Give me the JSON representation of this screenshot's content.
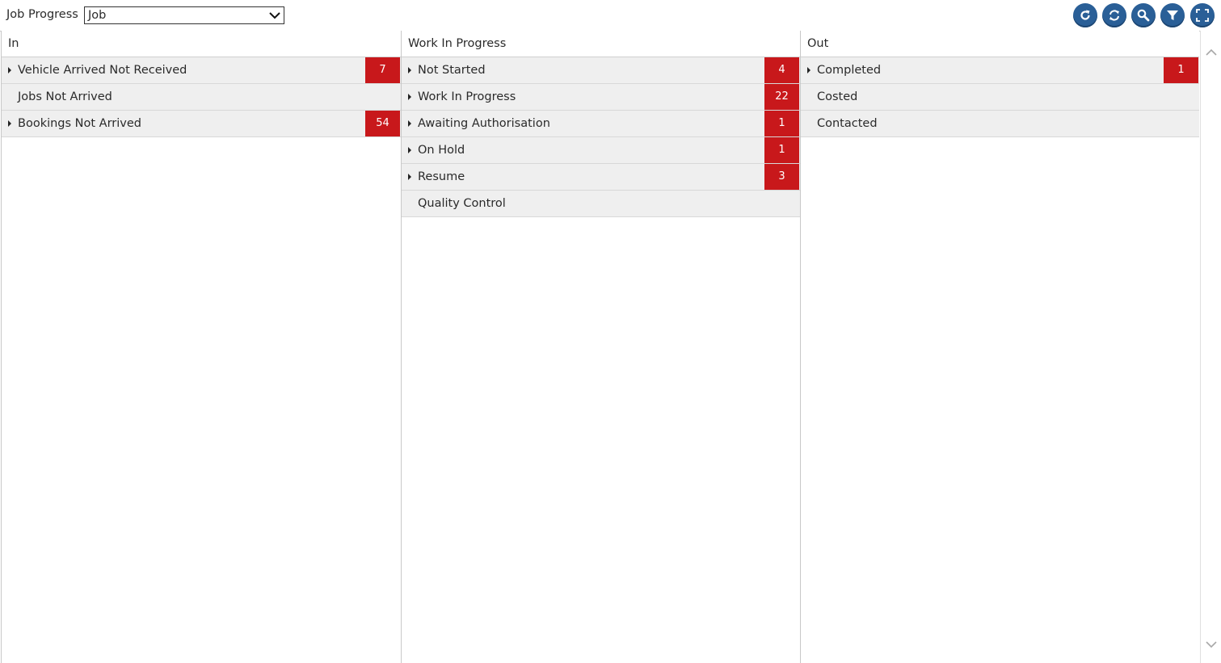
{
  "toolbar": {
    "page_label": "Job Progress",
    "view_select": {
      "value": "Job"
    },
    "buttons": [
      {
        "name": "refresh-button",
        "icon": "refresh-icon"
      },
      {
        "name": "sync-button",
        "icon": "sync-icon"
      },
      {
        "name": "search-button",
        "icon": "search-icon"
      },
      {
        "name": "filter-button",
        "icon": "filter-icon"
      },
      {
        "name": "fullscreen-button",
        "icon": "fullscreen-icon"
      }
    ],
    "accent_color": "#2a5f97"
  },
  "badge_color": "#c8181b",
  "columns": [
    {
      "title": "In",
      "rows": [
        {
          "label": "Vehicle Arrived Not Received",
          "expandable": true,
          "count": "7"
        },
        {
          "label": "Jobs Not Arrived",
          "expandable": false,
          "count": ""
        },
        {
          "label": "Bookings Not Arrived",
          "expandable": true,
          "count": "54"
        }
      ]
    },
    {
      "title": "Work In Progress",
      "rows": [
        {
          "label": "Not Started",
          "expandable": true,
          "count": "4"
        },
        {
          "label": "Work In Progress",
          "expandable": true,
          "count": "22"
        },
        {
          "label": "Awaiting Authorisation",
          "expandable": true,
          "count": "1"
        },
        {
          "label": "On Hold",
          "expandable": true,
          "count": "1"
        },
        {
          "label": "Resume",
          "expandable": true,
          "count": "3"
        },
        {
          "label": "Quality Control",
          "expandable": false,
          "count": ""
        }
      ]
    },
    {
      "title": "Out",
      "rows": [
        {
          "label": "Completed",
          "expandable": true,
          "count": "1"
        },
        {
          "label": "Costed",
          "expandable": false,
          "count": ""
        },
        {
          "label": "Contacted",
          "expandable": false,
          "count": ""
        }
      ]
    }
  ]
}
